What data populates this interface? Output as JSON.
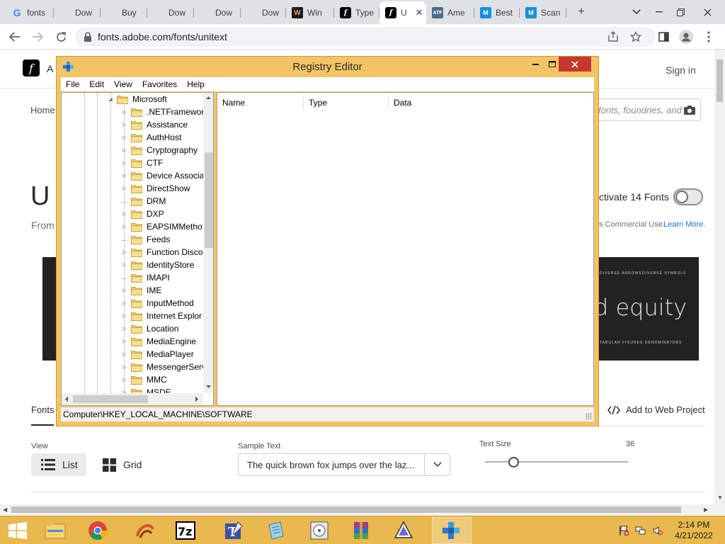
{
  "browser": {
    "tabs": [
      {
        "label": "fonts",
        "favicon": "google-icon"
      },
      {
        "label": "Dow",
        "favicon": "microsoft-icon"
      },
      {
        "label": "Buy",
        "favicon": "microsoft-icon"
      },
      {
        "label": "Dow",
        "favicon": "microsoft-icon"
      },
      {
        "label": "Dow",
        "favicon": "microsoft-icon"
      },
      {
        "label": "Dow",
        "favicon": "microsoft-icon"
      },
      {
        "label": "Win",
        "favicon": "w-icon"
      },
      {
        "label": "Type",
        "favicon": "adobe-fonts-icon"
      },
      {
        "label": "U",
        "favicon": "adobe-fonts-icon",
        "active": true
      },
      {
        "label": "Ame",
        "favicon": "atf-icon"
      },
      {
        "label": "Best",
        "favicon": "myfonts-icon"
      },
      {
        "label": "Scan",
        "favicon": "myfonts-icon"
      }
    ],
    "url": "fonts.adobe.com/fonts/unitext"
  },
  "page": {
    "brand_partial": "A",
    "sign_in": "Sign in",
    "nav_home": "Home",
    "search_placeholder": "fonts, foundries, and d",
    "title_partial": "U",
    "from_partial": "From",
    "activate_label": "ctivate 14 Fonts",
    "commercial_use": "s Commercial Use.",
    "learn_more": "Learn More.",
    "banner_text": "d equity",
    "banner_labels": [
      "DIVERSE ARROWS",
      "DIVERSE SYMBOLS",
      "TABULAR FIGURES",
      "DENOMINATORS"
    ],
    "fonts_tab": "Fonts",
    "add_to_web_project": "Add to Web Project",
    "view_label": "View",
    "view_list": "List",
    "view_grid": "Grid",
    "sample_text_label": "Sample Text",
    "sample_text_value": "The quick brown fox jumps over the laz...",
    "text_size_label": "Text Size",
    "text_size_value": "36",
    "text_size_fraction": 0.2
  },
  "regedit": {
    "title": "Registry Editor",
    "menu": [
      "File",
      "Edit",
      "View",
      "Favorites",
      "Help"
    ],
    "tree_parent": "Microsoft",
    "tree_items": [
      {
        "name": ".NETFramewor",
        "expandable": true
      },
      {
        "name": "Assistance",
        "expandable": true
      },
      {
        "name": "AuthHost",
        "expandable": true
      },
      {
        "name": "Cryptography",
        "expandable": true
      },
      {
        "name": "CTF",
        "expandable": true
      },
      {
        "name": "Device Associa",
        "expandable": true
      },
      {
        "name": "DirectShow",
        "expandable": true
      },
      {
        "name": "DRM",
        "expandable": false
      },
      {
        "name": "DXP",
        "expandable": true
      },
      {
        "name": "EAPSIMMetho",
        "expandable": true
      },
      {
        "name": "Feeds",
        "expandable": false
      },
      {
        "name": "Function Disco",
        "expandable": true
      },
      {
        "name": "IdentityStore",
        "expandable": true
      },
      {
        "name": "IMAPI",
        "expandable": false
      },
      {
        "name": "IME",
        "expandable": true
      },
      {
        "name": "InputMethod",
        "expandable": true
      },
      {
        "name": "Internet Explor",
        "expandable": true
      },
      {
        "name": "Location",
        "expandable": true
      },
      {
        "name": "MediaEngine",
        "expandable": true
      },
      {
        "name": "MediaPlayer",
        "expandable": true
      },
      {
        "name": "MessengerServ",
        "expandable": true
      },
      {
        "name": "MMC",
        "expandable": true
      },
      {
        "name": "MSDE",
        "expandable": true
      }
    ],
    "columns": [
      "Name",
      "Type",
      "Data"
    ],
    "status_path": "Computer\\HKEY_LOCAL_MACHINE\\SOFTWARE"
  },
  "taskbar": {
    "apps": [
      "file-explorer-icon",
      "chrome-icon",
      "app-swirl-icon",
      "7zip-icon",
      "typing-app-icon",
      "notepad-icon",
      "disk-icon",
      "winrar-icon",
      "inkscape-icon",
      "regedit-icon"
    ],
    "time": "2:14 PM",
    "date": "4/21/2022"
  },
  "colors": {
    "window_frame": "#f2c464",
    "taskbar": "#e9b84e",
    "close_button": "#c7372f",
    "link": "#1473e6"
  }
}
